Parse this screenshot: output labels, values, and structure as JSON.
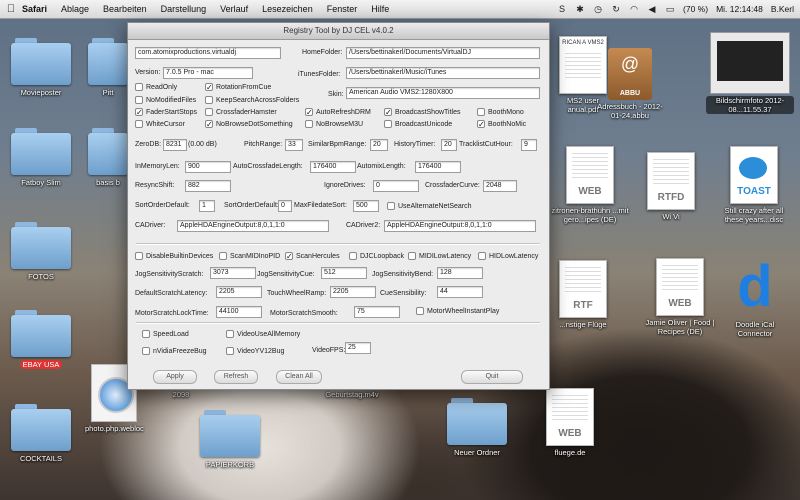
{
  "menubar": {
    "app": "Safari",
    "items": [
      "Ablage",
      "Bearbeiten",
      "Darstellung",
      "Verlauf",
      "Lesezeichen",
      "Fenster",
      "Hilfe"
    ],
    "battery": "(70 %)",
    "clock": "Mi. 12:14:48",
    "user": "B.Kerl"
  },
  "desktop": {
    "left_icons": [
      "Movieposter",
      "Fatboy Slim",
      "FOTOS",
      "EBAY USA",
      "COCKTAILS"
    ],
    "partial_labels": [
      "Pitt",
      "basis b"
    ],
    "mid_icons": [
      "photo.php.webloc",
      "PAPIERKORB",
      "Geburtstag.m4v",
      "Neuer Ordner",
      "fluege.de"
    ],
    "mid_partial": "2098",
    "right_icons": [
      {
        "label": "MS2 user anual.pdf",
        "tag": ""
      },
      {
        "label": "Adressbuch - 2012-01-24.abbu",
        "tag": "ABBU"
      },
      {
        "label": "Bildschirmfoto 2012-08...11.55.37",
        "tag": ""
      },
      {
        "label": "zitronen-brathuhn ...mit gero...ipes (DE)",
        "tag": "WEB"
      },
      {
        "label": "Wi Vi",
        "tag": "RTFD"
      },
      {
        "label": "Still crazy after all these years...disc",
        "tag": "TOAST"
      },
      {
        "label": "...nstige Flüge",
        "tag": "RTF"
      },
      {
        "label": "Jamie Oliver | Food | Recipes (DE)",
        "tag": "WEB"
      },
      {
        "label": "Doodle iCal Connector",
        "tag": "d"
      }
    ],
    "doc_header": "RICAN A VMS2"
  },
  "window": {
    "title": "Registry Tool by DJ CEL v4.0.2",
    "bundle": "com.atomixproductions.virtualdj",
    "home_label": "HomeFolder:",
    "home_value": "/Users/bettinakerl/Documents/VirtualDJ",
    "version_label": "Version:",
    "version_value": "7.0.5 Pro - mac",
    "itunes_label": "iTunesFolder:",
    "itunes_value": "/Users/bettinakerl/Music/iTunes",
    "skin_label": "Skin:",
    "skin_value": "American Audio VMS2:1280X800",
    "checks1": [
      {
        "label": "ReadOnly",
        "on": false
      },
      {
        "label": "RotationFromCue",
        "on": true
      },
      {
        "label": "NoModifiedFiles",
        "on": false
      },
      {
        "label": "KeepSearchAcrossFolders",
        "on": false
      },
      {
        "label": "FaderStartStops",
        "on": true
      },
      {
        "label": "CrossfaderHamster",
        "on": false
      },
      {
        "label": "AutoRefreshDRM",
        "on": true
      },
      {
        "label": "BroadcastShowTitles",
        "on": true
      },
      {
        "label": "BoothMono",
        "on": false
      },
      {
        "label": "WhiteCursor",
        "on": false
      },
      {
        "label": "NoBrowseDotSomething",
        "on": true
      },
      {
        "label": "NoBrowseM3U",
        "on": false
      },
      {
        "label": "BroadcastUnicode",
        "on": false
      },
      {
        "label": "BoothNoMic",
        "on": true
      }
    ],
    "fields": {
      "zerodb_label": "ZeroDB:",
      "zerodb": "8231",
      "zerodb_db": "(0.00 dB)",
      "pitch_label": "PitchRange:",
      "pitch": "33",
      "similar_label": "SimilarBpmRange:",
      "similar": "20",
      "history_label": "HistoryTimer:",
      "history": "20",
      "tracklist_label": "TracklistCutHour:",
      "tracklist": "9",
      "inmem_label": "InMemoryLen:",
      "inmem": "900",
      "autocross_label": "AutoCrossfadeLength:",
      "autocross": "176400",
      "automix_label": "AutomixLength:",
      "automix": "176400",
      "resync_label": "ResyncShift:",
      "resync": "882",
      "ignore_label": "IgnoreDrives:",
      "ignore": "0",
      "crosscurve_label": "CrossfaderCurve:",
      "crosscurve": "2048",
      "sortorder_label": "SortOrderDefault:",
      "sortorder": "1",
      "sortorder2_label": "SortOrderDefault:",
      "sortorder2": "0",
      "maxfile_label": "MaxFiledateSort:",
      "maxfile": "500",
      "usealt_label": "UseAlternateNetSearch",
      "cadriver_label": "CADriver:",
      "cadriver": "AppleHDAEngineOutput:8,0,1,1:0",
      "cadriver2_label": "CADriver2:",
      "cadriver2": "AppleHDAEngineOutput:8,0,1,1:0"
    },
    "checks2": [
      {
        "label": "DisableBuiltinDevices",
        "on": false
      },
      {
        "label": "ScanMIDInoPID",
        "on": false
      },
      {
        "label": "ScanHercules",
        "on": true
      },
      {
        "label": "DJCLoopback",
        "on": false
      },
      {
        "label": "MIDILowLatency",
        "on": false
      },
      {
        "label": "HIDLowLatency",
        "on": false
      }
    ],
    "fields2": {
      "jogscratch_label": "JogSensitivityScratch:",
      "jogscratch": "3073",
      "jogcue_label": "JogSensitivityCue:",
      "jogcue": "512",
      "jogbend_label": "JogSensitivityBend:",
      "jogbend": "128",
      "defscratch_label": "DefaultScratchLatency:",
      "defscratch": "2205",
      "touchramp_label": "TouchWheelRamp:",
      "touchramp": "2205",
      "cuesens_label": "CueSensibility:",
      "cuesens": "44",
      "motorlock_label": "MotorScratchLockTime:",
      "motorlock": "44100",
      "motorsmooth_label": "MotorScratchSmooth:",
      "motorsmooth": "75",
      "motorinst_label": "MotorWheelInstantPlay"
    },
    "checks3": [
      {
        "label": "SpeedLoad",
        "on": false
      },
      {
        "label": "VideoUseAllMemory",
        "on": false
      },
      {
        "label": "nVidiaFreezeBug",
        "on": false
      },
      {
        "label": "VideoYV12Bug",
        "on": false
      }
    ],
    "videofps_label": "VideoFPS:",
    "videofps": "25",
    "buttons": {
      "apply": "Apply",
      "refresh": "Refresh",
      "clear": "Clean All",
      "quit": "Quit"
    }
  }
}
